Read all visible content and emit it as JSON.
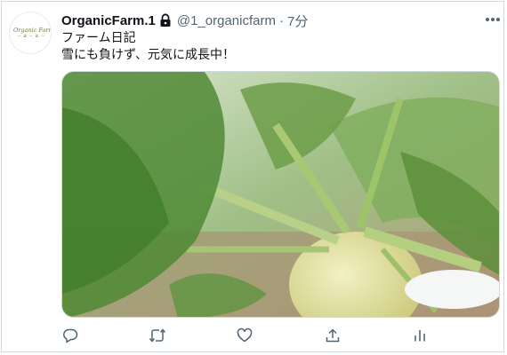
{
  "tweet": {
    "display_name": "OrganicFarm.1",
    "handle": "@1_organicfarm",
    "separator": "·",
    "time": "7分",
    "text_lines": [
      "ファーム日記",
      "雪にも負けず、元気に成長中！"
    ],
    "avatar_logo": {
      "top": "Organic Farm",
      "bottom": "— ✿ — ✿ —"
    }
  },
  "icons": {
    "lock": "lock-icon",
    "more": "more-icon",
    "reply": "reply-icon",
    "retweet": "retweet-icon",
    "like": "like-icon",
    "share": "share-icon",
    "analytics": "analytics-icon"
  },
  "colors": {
    "text_primary": "#0f1419",
    "text_secondary": "#536471",
    "border": "#cfd9de"
  }
}
